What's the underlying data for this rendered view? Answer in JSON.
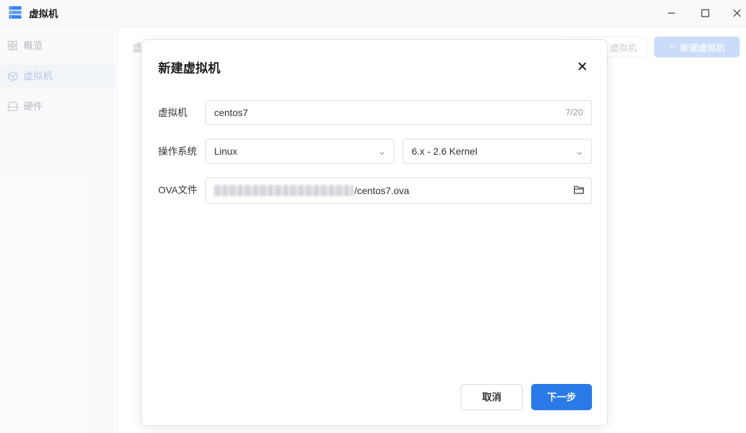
{
  "window": {
    "title": "虚拟机",
    "icon": "server-stack-icon",
    "controls": [
      "minimize-icon",
      "maximize-icon",
      "close-icon"
    ]
  },
  "sidebar": {
    "items": [
      {
        "label": "概览",
        "icon": "grid-icon",
        "active": false
      },
      {
        "label": "虚拟机",
        "icon": "cube-icon",
        "active": true
      },
      {
        "label": "硬件",
        "icon": "drive-icon",
        "active": false
      }
    ]
  },
  "main": {
    "breadcrumb": "虚",
    "vm_button_label": "虚拟机",
    "new_vm_button_label": "新建虚拟机",
    "new_vm_button_icon": "+"
  },
  "dialog": {
    "title": "新建虚拟机",
    "name_field": {
      "label": "虚拟机",
      "value": "centos7",
      "counter": "7/20"
    },
    "os_field": {
      "label": "操作系统",
      "os_type": "Linux",
      "os_version": "6.x - 2.6 Kernel"
    },
    "ova_field": {
      "label": "OVA文件",
      "path_suffix": "/centos7.ova",
      "path_prefix_blurred": true
    },
    "cancel_label": "取消",
    "next_label": "下一步"
  },
  "colors": {
    "primary": "#2a7be8",
    "primary_disabled": "#b9d0f6",
    "sidebar_bg": "#f8f9fb"
  }
}
